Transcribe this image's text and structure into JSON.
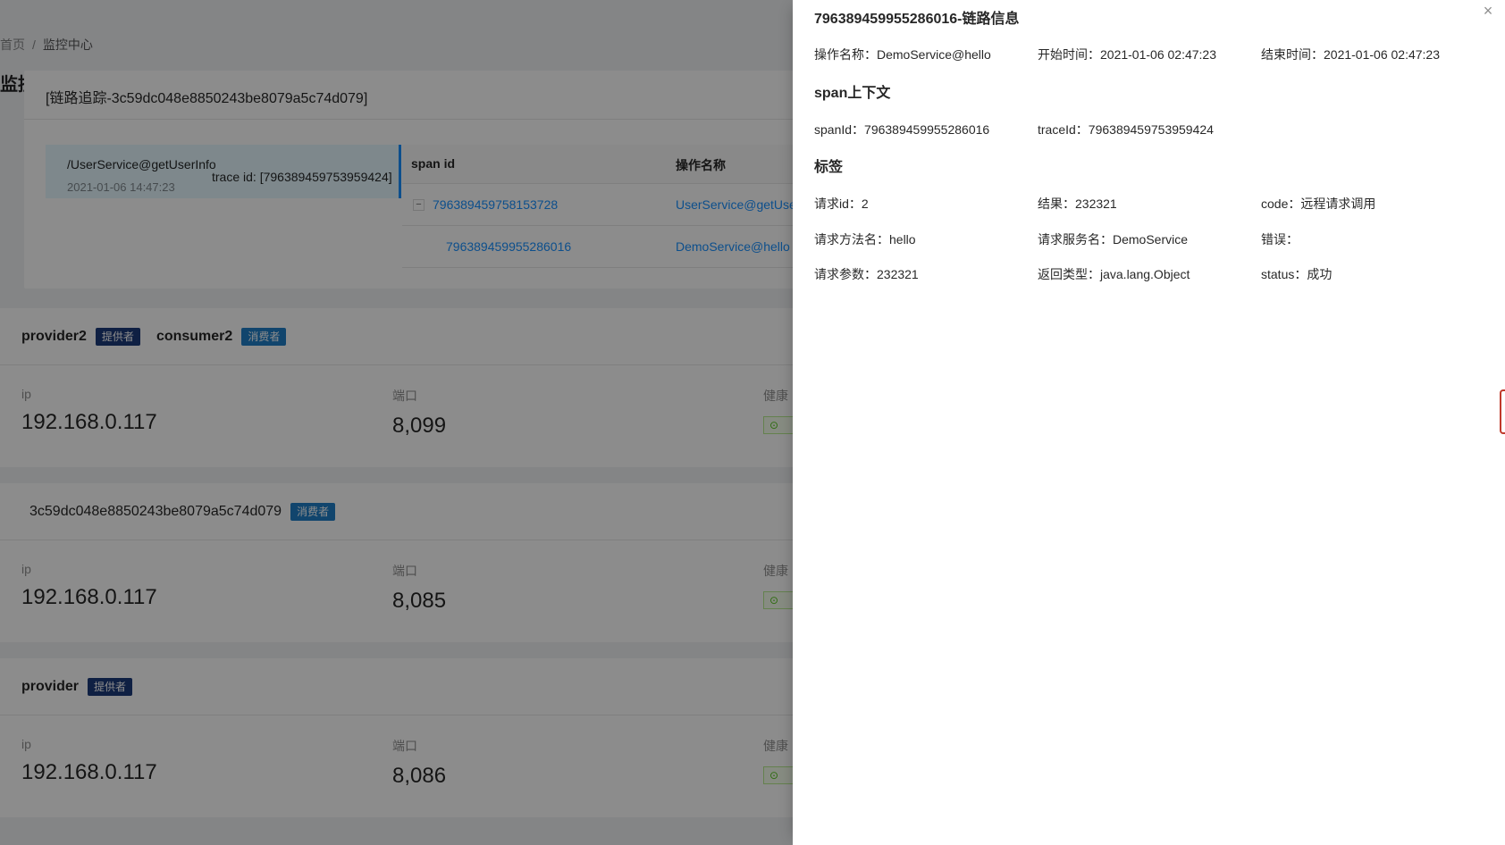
{
  "background": {
    "breadcrumb": {
      "home": "首页",
      "current": "监控中心"
    },
    "page_title": "监控",
    "cards": [
      {
        "names": [
          {
            "name": "provider2",
            "tag": "提供者"
          },
          {
            "name": "consumer2",
            "tag": "消费者"
          }
        ],
        "ip_label": "ip",
        "ip": "192.168.0.117",
        "port_label": "端口",
        "port": "8,099",
        "health_label": "健康"
      },
      {
        "names": [
          {
            "name": "3c59dc048e8850243be8079a5c74d079",
            "tag": "消费者"
          }
        ],
        "ip_label": "ip",
        "ip": "192.168.0.117",
        "port_label": "端口",
        "port": "8,085",
        "health_label": "健康"
      },
      {
        "names": [
          {
            "name": "provider",
            "tag": "提供者"
          }
        ],
        "ip_label": "ip",
        "ip": "192.168.0.117",
        "port_label": "端口",
        "port": "8,086",
        "health_label": "健康"
      }
    ]
  },
  "modal": {
    "title": "[链路追踪-3c59dc048e8850243be8079a5c74d079]",
    "trace": {
      "operation": "/UserService@getUserInfo",
      "trace_id": "trace id: [796389459753959424]",
      "timestamp": "2021-01-06 14:47:23"
    },
    "table": {
      "headers": [
        "span id",
        "操作名称"
      ],
      "rows": [
        {
          "span_id": "796389459758153728",
          "op": "UserService@getUserInfo",
          "expand": "−"
        },
        {
          "span_id": "796389459955286016",
          "op": "DemoService@hello"
        }
      ]
    }
  },
  "drawer": {
    "title": "796389459955286016-链路信息",
    "info": {
      "operation": "操作名称：DemoService@hello",
      "start": "开始时间：2021-01-06 02:47:23",
      "end": "结束时间：2021-01-06 02:47:23"
    },
    "span_context_title": "span上下文",
    "span_context": {
      "span_id": "spanId：796389459955286016",
      "trace_id": "traceId：796389459753959424"
    },
    "tags_title": "标签",
    "tags": {
      "request_id": "请求id：2",
      "result": "结果：232321",
      "code": "code：远程请求调用",
      "method": "请求方法名：hello",
      "service": "请求服务名：DemoService",
      "error": "错误：",
      "params": "请求参数：232321",
      "return_type": "返回类型：java.lang.Object",
      "status": "status：成功"
    },
    "close_icon": "×"
  }
}
